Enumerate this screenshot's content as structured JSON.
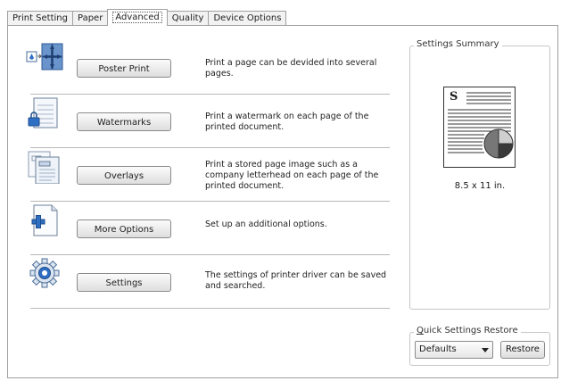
{
  "tabs": [
    {
      "label": "Print Setting",
      "active": false
    },
    {
      "label": "Paper",
      "active": false
    },
    {
      "label": "Advanced",
      "active": true
    },
    {
      "label": "Quality",
      "active": false
    },
    {
      "label": "Device Options",
      "active": false
    }
  ],
  "options": [
    {
      "icon": "poster-print-icon",
      "button": "Poster Print",
      "description": "Print a page can be devided into several pages."
    },
    {
      "icon": "watermark-icon",
      "button": "Watermarks",
      "description": "Print a watermark on each page of the printed document."
    },
    {
      "icon": "overlay-icon",
      "button": "Overlays",
      "description": "Print a stored page image such as a company letterhead on each page of the printed document."
    },
    {
      "icon": "more-options-icon",
      "button": "More Options",
      "description": "Set up an additional options."
    },
    {
      "icon": "gear-icon",
      "button": "Settings",
      "description": "The settings of printer driver can be saved and searched."
    }
  ],
  "summary": {
    "title": "Settings Summary",
    "paper_size": "8.5 x 11 in.",
    "doc_letter": "S"
  },
  "quick_restore": {
    "title_prefix": "Q",
    "title_rest": "uick Settings Restore",
    "selected": "Defaults",
    "restore_label": "Restore"
  }
}
